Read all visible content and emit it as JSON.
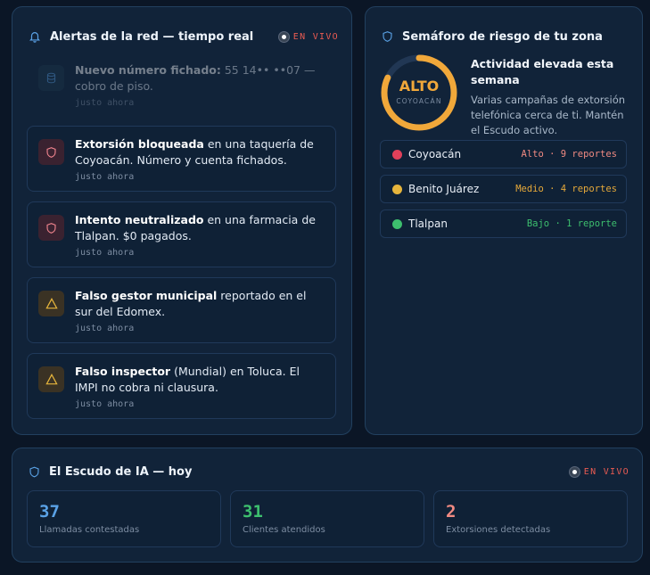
{
  "colors": {
    "background": "#0b1626",
    "panel": "#112339",
    "live_red": "#ea5b52",
    "amber": "#f1a83a",
    "accent_blue": "#5aa2e6",
    "green": "#3dbf6e",
    "salmon": "#f08a82"
  },
  "alerts_panel": {
    "title": "Alertas de la red — tiempo real",
    "live_label": "EN VIVO",
    "header_icon": "bell-icon",
    "items": [
      {
        "icon": "database-icon",
        "strong": "Nuevo número fichado:",
        "rest": " 55 14•• ••07 — cobro de piso.",
        "time": "justo ahora"
      },
      {
        "icon": "shield-icon",
        "strong": "Extorsión bloqueada",
        "rest": " en una taquería de Coyoacán. Número y cuenta fichados.",
        "time": "justo ahora"
      },
      {
        "icon": "shield-icon",
        "strong": "Intento neutralizado",
        "rest": " en una farmacia de Tlalpan. $0 pagados.",
        "time": "justo ahora"
      },
      {
        "icon": "warning-icon",
        "strong": "Falso gestor municipal",
        "rest": " reportado en el sur del Edomex.",
        "time": "justo ahora"
      },
      {
        "icon": "warning-icon",
        "strong": "Falso inspector",
        "rest": " (Mundial) en Toluca. El IMPI no cobra ni clausura.",
        "time": "justo ahora"
      }
    ]
  },
  "risk_panel": {
    "title": "Semáforo de riesgo de tu zona",
    "header_icon": "pin-icon",
    "gauge_value": "ALTO",
    "gauge_zone": "COYOACÁN",
    "gauge_level": 0.82,
    "headline": "Actividad elevada esta semana",
    "description": "Varias campañas de extorsión telefónica cerca de ti. Mantén el Escudo activo.",
    "zones": [
      {
        "name": "Coyoacán",
        "level": "Alto · 9 reportes",
        "dot_color": "#e0405a",
        "level_color": "#f08a82"
      },
      {
        "name": "Benito Juárez",
        "level": "Medio · 4 reportes",
        "dot_color": "#e6b53c",
        "level_color": "#e6a93a"
      },
      {
        "name": "Tlalpan",
        "level": "Bajo · 1 reporte",
        "dot_color": "#3dbf6e",
        "level_color": "#3dbf6e"
      }
    ]
  },
  "shield_panel": {
    "title": "El Escudo de IA — hoy",
    "header_icon": "shield-icon",
    "live_label": "EN VIVO",
    "stats": [
      {
        "value": "37",
        "label": "Llamadas contestadas",
        "color": "#5aa2e6"
      },
      {
        "value": "31",
        "label": "Clientes atendidos",
        "color": "#3dbf6e"
      },
      {
        "value": "2",
        "label": "Extorsiones detectadas",
        "color": "#f08a82"
      }
    ]
  }
}
